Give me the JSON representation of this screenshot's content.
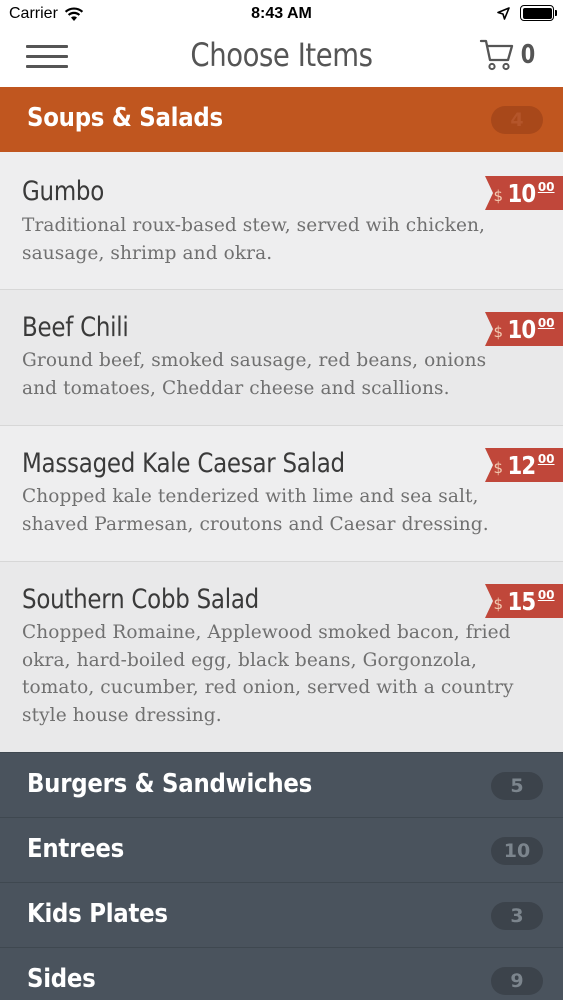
{
  "status_bar": {
    "carrier": "Carrier",
    "time": "8:43 AM"
  },
  "nav": {
    "title": "Choose Items",
    "cart_count": "0"
  },
  "categories": [
    {
      "name": "Soups & Salads",
      "count": "4"
    },
    {
      "name": "Burgers & Sandwiches",
      "count": "5"
    },
    {
      "name": "Entrees",
      "count": "10"
    },
    {
      "name": "Kids Plates",
      "count": "3"
    },
    {
      "name": "Sides",
      "count": "9"
    }
  ],
  "items": [
    {
      "name": "Gumbo",
      "desc": "Traditional roux-based stew, served wih chicken, sausage, shrimp and okra.",
      "currency": "$",
      "price": "10",
      "cents": "00"
    },
    {
      "name": "Beef Chili",
      "desc": "Ground beef, smoked sausage, red beans, onions and tomatoes, Cheddar cheese and scallions.",
      "currency": "$",
      "price": "10",
      "cents": "00"
    },
    {
      "name": "Massaged Kale Caesar Salad",
      "desc": "Chopped kale tenderized with lime and sea salt, shaved Parmesan, croutons and Caesar dressing.",
      "currency": "$",
      "price": "12",
      "cents": "00"
    },
    {
      "name": "Southern Cobb Salad",
      "desc": "Chopped Romaine, Applewood smoked bacon, fried okra, hard-boiled egg, black beans, Gorgonzola, tomato, cucumber, red onion, served with a country style house dressing.",
      "currency": "$",
      "price": "15",
      "cents": "00"
    }
  ],
  "colors": {
    "accent": "#c0561f",
    "price_tag": "#c0473a",
    "category_dark": "#4a535d"
  },
  "icons": {
    "menu": "hamburger-icon",
    "cart": "cart-icon",
    "wifi": "wifi-icon",
    "location": "location-arrow-icon",
    "battery": "battery-icon"
  }
}
